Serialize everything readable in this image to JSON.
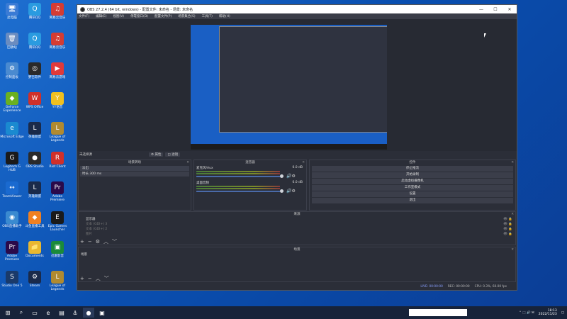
{
  "desktop_icons": [
    {
      "label": "此电脑",
      "color": "#3a7bd5",
      "glyph": "🖥"
    },
    {
      "label": "腾讯QQ",
      "color": "#2a9be0",
      "glyph": "Q"
    },
    {
      "label": "网易云音乐",
      "color": "#d43c33",
      "glyph": "♫"
    },
    {
      "label": "回收站",
      "color": "#6a8cc0",
      "glyph": "🗑"
    },
    {
      "label": "腾讯QQ",
      "color": "#2a9be0",
      "glyph": "Q"
    },
    {
      "label": "网易云音乐",
      "color": "#d43c33",
      "glyph": "♫"
    },
    {
      "label": "控制面板",
      "color": "#4a8ad0",
      "glyph": "⚙"
    },
    {
      "label": "野吉软件",
      "color": "#2a2a2a",
      "glyph": "◎"
    },
    {
      "label": "网易云游戏",
      "color": "#e03a3a",
      "glyph": "▶"
    },
    {
      "label": "GeForce Experience",
      "color": "#6ab020",
      "glyph": "◆"
    },
    {
      "label": "WPS Office",
      "color": "#d0302a",
      "glyph": "W"
    },
    {
      "label": "YY语音",
      "color": "#f0c020",
      "glyph": "Y"
    },
    {
      "label": "Microsoft Edge",
      "color": "#1a8ad0",
      "glyph": "e"
    },
    {
      "label": "英雄联盟",
      "color": "#1a2a4a",
      "glyph": "L"
    },
    {
      "label": "League of Legends",
      "color": "#b08a30",
      "glyph": "L"
    },
    {
      "label": "Logitech G HUB",
      "color": "#1a1a1a",
      "glyph": "G"
    },
    {
      "label": "OBS Studio",
      "color": "#2a2a2a",
      "glyph": "●"
    },
    {
      "label": "Riot Client",
      "color": "#d0302a",
      "glyph": "R"
    },
    {
      "label": "TeamViewer",
      "color": "#1a6ad0",
      "glyph": "↔"
    },
    {
      "label": "英雄联盟",
      "color": "#1a2a4a",
      "glyph": "L"
    },
    {
      "label": "Adobe Premiere",
      "color": "#2a0a4a",
      "glyph": "Pr"
    },
    {
      "label": "OBS直播助手",
      "color": "#3a8ad0",
      "glyph": "◉"
    },
    {
      "label": "斗鱼直播工具",
      "color": "#f08020",
      "glyph": "◆"
    },
    {
      "label": "Epic Games Launcher",
      "color": "#1a1a1a",
      "glyph": "E"
    },
    {
      "label": "Adobe Premiere",
      "color": "#2a0a4a",
      "glyph": "Pr"
    },
    {
      "label": "Documents",
      "color": "#e8b830",
      "glyph": "📁"
    },
    {
      "label": "迅雷影音",
      "color": "#1a8a3a",
      "glyph": "▣"
    },
    {
      "label": "Studio One 5",
      "color": "#1a3a6a",
      "glyph": "S"
    },
    {
      "label": "Steam",
      "color": "#1a2a4a",
      "glyph": "⚙"
    },
    {
      "label": "League of Legends",
      "color": "#b08a30",
      "glyph": "L"
    }
  ],
  "window": {
    "title": "OBS 27.2.4 (64 bit, windows) - 配置文件: 未命名 - 场景: 未命名",
    "menu": [
      "文件(F)",
      "编辑(E)",
      "视图(V)",
      "停靠窗口(D)",
      "配置文件(P)",
      "场景集合(S)",
      "工具(T)",
      "帮助(H)"
    ],
    "scenebar_title": "未选择源",
    "scenebar_props": "⚙ 属性",
    "scenebar_filters": "◫ 滤镜"
  },
  "docks": {
    "sources": {
      "title": "场景转场",
      "rows": [
        {
          "label": "淡出"
        },
        {
          "label": "时长    300 ms"
        }
      ]
    },
    "mixer": {
      "title": "混音器",
      "channels": [
        {
          "name": "麦克风/Aux",
          "db": "0.0 dB"
        },
        {
          "name": "桌面音频",
          "db": "0.0 dB"
        }
      ]
    },
    "controls": {
      "title": "控件",
      "buttons": [
        "停止推流",
        "开始录制",
        "启动虚拟摄像机",
        "工作室模式",
        "设置",
        "退出"
      ]
    },
    "scenes": {
      "title": "来源",
      "items": [
        {
          "label": "显示器"
        },
        {
          "label": "文本 (GDI+) 3"
        },
        {
          "label": "文本 (GDI+) 2"
        },
        {
          "label": "图片"
        }
      ]
    },
    "scenes_bottom": {
      "title": "场景",
      "items": [
        {
          "label": "场景"
        }
      ]
    }
  },
  "statusbar": {
    "live": "LIVE: 00:00:00",
    "rec": "REC: 00:00:00",
    "cpu": "CPU: 0.3%, 60.00 fps"
  },
  "taskbar": {
    "time": "18:13",
    "date": "2022/11/23"
  }
}
